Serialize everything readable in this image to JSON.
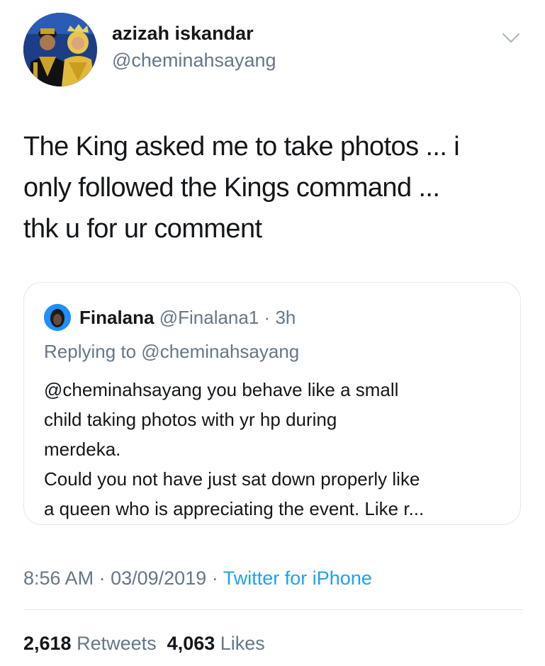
{
  "author": {
    "display_name": "azizah iskandar",
    "handle": "@cheminahsayang"
  },
  "tweet": {
    "lines": [
      "The King asked me to take photos ... i",
      "only followed the Kings command ...",
      "thk u for ur comment"
    ]
  },
  "quoted": {
    "display_name": "Finalana",
    "handle": "@Finalana1",
    "separator": "·",
    "time": "3h",
    "replying_to": "Replying to @cheminahsayang",
    "lines": [
      "@cheminahsayang  you behave like a small",
      "child taking photos with yr hp during",
      "merdeka.",
      "Could you not have just sat down properly like",
      "a queen who is appreciating the event. Like r..."
    ]
  },
  "meta": {
    "time": "8:56 AM",
    "separator": "·",
    "date": "03/09/2019",
    "source": "Twitter for iPhone"
  },
  "stats": {
    "retweets_count": "2,618",
    "retweets_label": "Retweets",
    "likes_count": "4,063",
    "likes_label": "Likes"
  },
  "icons": {
    "more": "chevron-down-icon"
  },
  "colors": {
    "text": "#14171a",
    "secondary": "#657786",
    "link": "#1da1f2",
    "border": "#e1e8ed"
  }
}
